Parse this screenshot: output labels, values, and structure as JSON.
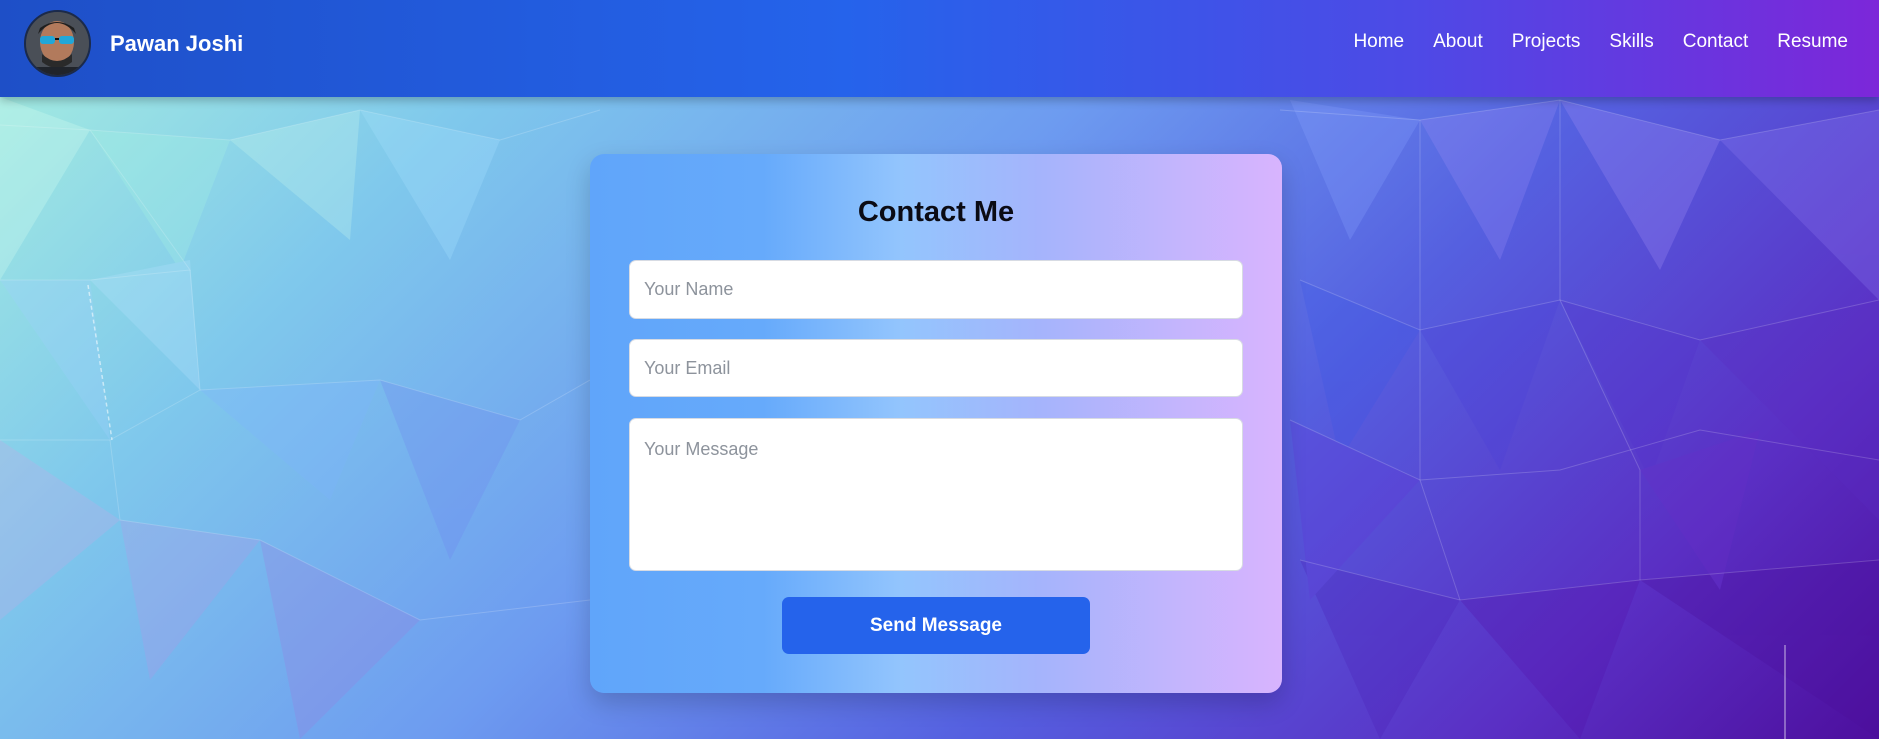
{
  "header": {
    "brand_name": "Pawan Joshi",
    "nav": [
      {
        "label": "Home"
      },
      {
        "label": "About"
      },
      {
        "label": "Projects"
      },
      {
        "label": "Skills"
      },
      {
        "label": "Contact"
      },
      {
        "label": "Resume"
      }
    ]
  },
  "contact": {
    "title": "Contact Me",
    "name_placeholder": "Your Name",
    "email_placeholder": "Your Email",
    "message_placeholder": "Your Message",
    "submit_label": "Send Message"
  },
  "colors": {
    "navbar_start": "#1e4fc7",
    "navbar_end": "#7c27d9",
    "button": "#2563eb",
    "title": "#0b0b14"
  }
}
